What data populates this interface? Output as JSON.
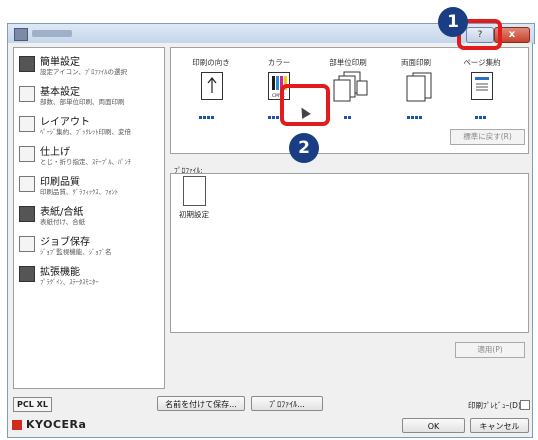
{
  "window": {
    "close_glyph": "x",
    "help_glyph": "?"
  },
  "sidebar": {
    "items": [
      {
        "title": "簡単設定",
        "subtitle": "設定アイコン、ﾌﾟﾛﾌｧｲﾙの選択",
        "icon": "quick-settings-icon"
      },
      {
        "title": "基本設定",
        "subtitle": "部数、部単位印刷、両面印刷",
        "icon": "basic-settings-icon"
      },
      {
        "title": "レイアウト",
        "subtitle": "ﾍﾟｰｼﾞ集約、ﾌﾞｯｸﾚｯﾄ印刷、変倍",
        "icon": "layout-icon"
      },
      {
        "title": "仕上げ",
        "subtitle": "とじ・折り指定、ｽﾃｰﾌﾟﾙ、ﾊﾟﾝﾁ",
        "icon": "finishing-icon"
      },
      {
        "title": "印刷品質",
        "subtitle": "印刷品質、ｸﾞﾗﾌｨｯｸｽ、ﾌｫﾝﾄ",
        "icon": "print-quality-icon"
      },
      {
        "title": "表紙/合紙",
        "subtitle": "表紙付け、合紙",
        "icon": "cover-icon"
      },
      {
        "title": "ジョブ保存",
        "subtitle": "ｼﾞｮﾌﾞ監視機能、ｼﾞｮﾌﾞ名",
        "icon": "job-storage-icon"
      },
      {
        "title": "拡張機能",
        "subtitle": "ﾌﾟﾗｸﾞｲﾝ、ｽﾃｰﾀｽﾓﾆﾀｰ",
        "icon": "extension-icon"
      }
    ]
  },
  "quick": {
    "columns": [
      "印刷の向き",
      "カラー",
      "部単位印刷",
      "両面印刷",
      "ページ集約"
    ],
    "reset_label": "標準に戻す(R)"
  },
  "profile": {
    "label": "ﾌﾟﾛﾌｧｲﾙ:",
    "items": [
      {
        "name": "初期設定"
      }
    ],
    "apply_label": "適用(P)"
  },
  "footer": {
    "pcl": "PCL XL",
    "save_as": "名前を付けて保存...",
    "profile_btn": "ﾌﾟﾛﾌｧｲﾙ...",
    "preview": "印刷ﾌﾟﾚﾋﾞｭｰ(D)",
    "ok": "OK",
    "cancel": "キャンセル",
    "brand": "KYOCERa"
  },
  "callouts": [
    "1",
    "2"
  ],
  "colors": {
    "highlight": "#e21c1c",
    "marker": "#1a3d84",
    "brand": "#d32a1e",
    "accent": "#1f4fb0"
  }
}
